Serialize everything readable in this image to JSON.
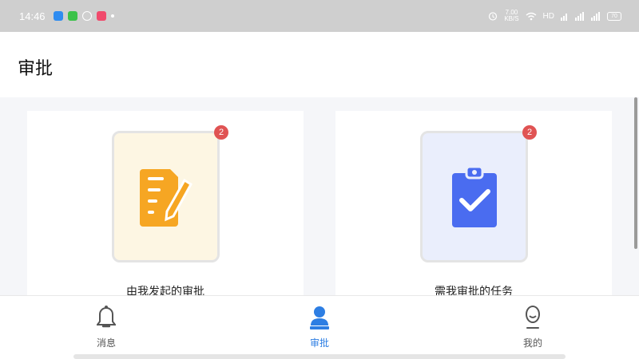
{
  "status_bar": {
    "time": "14:46",
    "speed_value": "7.00",
    "speed_unit": "KB/S",
    "network": "HD",
    "battery": "70"
  },
  "header": {
    "title": "审批"
  },
  "cards": [
    {
      "label": "由我发起的审批",
      "badge": "2",
      "icon": "document-pen-icon",
      "color": "#f6a623"
    },
    {
      "label": "需我审批的任务",
      "badge": "2",
      "icon": "clipboard-check-icon",
      "color": "#4a6cf0"
    }
  ],
  "bottom_nav": [
    {
      "label": "消息",
      "icon": "bell-icon",
      "active": false
    },
    {
      "label": "审批",
      "icon": "user-stamp-icon",
      "active": true
    },
    {
      "label": "我的",
      "icon": "profile-icon",
      "active": false
    }
  ],
  "colors": {
    "accent": "#2d7ee3",
    "badge": "#e05353"
  }
}
